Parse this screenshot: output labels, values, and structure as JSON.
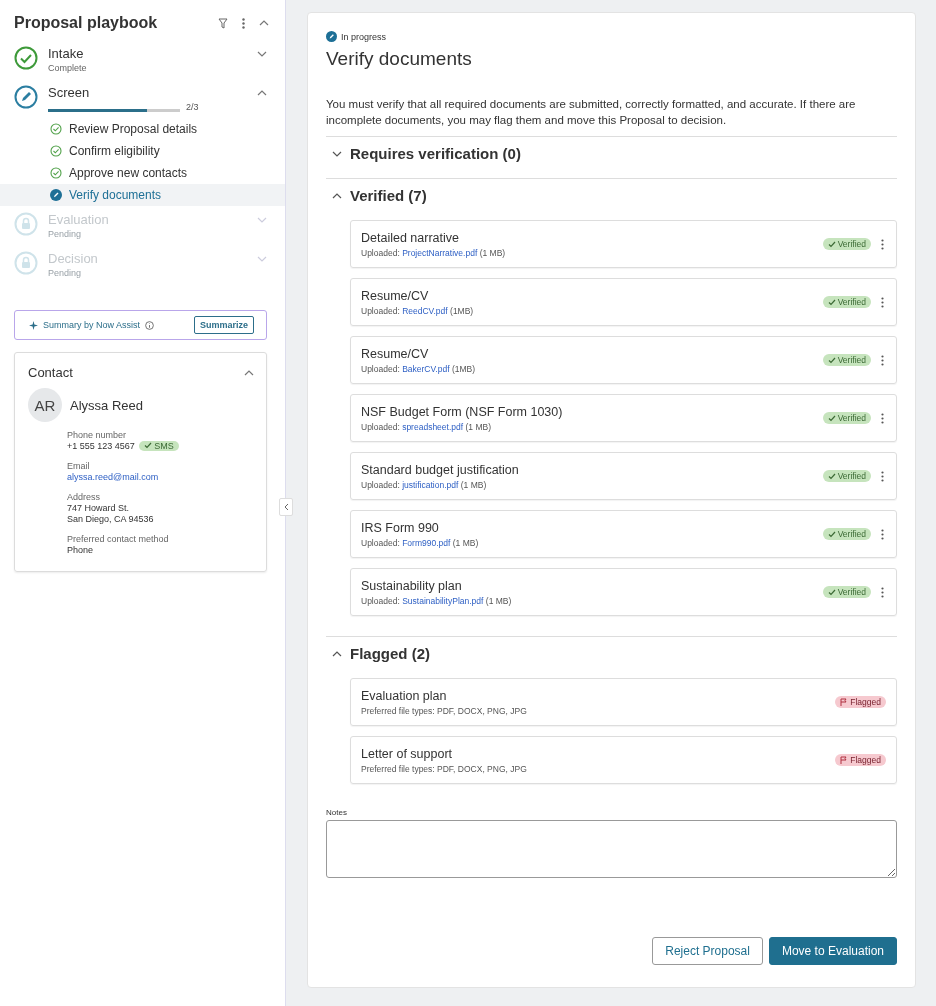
{
  "sidebar": {
    "title": "Proposal playbook",
    "stages": [
      {
        "name": "Intake",
        "kind": "complete",
        "subtitle": "Complete",
        "expanded": false
      },
      {
        "name": "Screen",
        "kind": "active",
        "progress": {
          "level": 0.75,
          "reading": "2/3"
        },
        "expanded": true,
        "steps": [
          {
            "label": "Review Proposal details",
            "done": true,
            "selected": false
          },
          {
            "label": "Confirm eligibility",
            "done": true,
            "selected": false
          },
          {
            "label": "Approve new contacts",
            "done": true,
            "selected": false
          },
          {
            "label": "Verify documents",
            "done": false,
            "selected": true
          }
        ]
      },
      {
        "name": "Evaluation",
        "kind": "locked",
        "subtitle": "Pending",
        "expanded": false
      },
      {
        "name": "Decision",
        "kind": "locked",
        "subtitle": "Pending",
        "expanded": false
      }
    ],
    "assist": {
      "label": "Summary by Now Assist",
      "button": "Summarize"
    },
    "contact": {
      "title": "Contact",
      "expanded": true,
      "initials": "AR",
      "name": "Alyssa Reed",
      "fields": [
        {
          "kind": "phone",
          "label": "Phone number",
          "value": "+1 555 123 4567",
          "badge": "SMS"
        },
        {
          "kind": "link",
          "label": "Email",
          "value": "alyssa.reed@mail.com"
        },
        {
          "kind": "text",
          "label": "Address",
          "lines": [
            "747 Howard St.",
            "San Diego, CA 94536"
          ]
        },
        {
          "kind": "text",
          "label": "Preferred contact method",
          "lines": [
            "Phone"
          ]
        }
      ]
    }
  },
  "main": {
    "status": "In progress",
    "title": "Verify documents",
    "description": "You must verify that all required documents are submitted, correctly formatted, and accurate. If there are incomplete documents, you may flag them and move this Proposal to decision.",
    "sections": [
      {
        "title": "Requires verification (0)",
        "expanded": false
      },
      {
        "title": "Verified (7)",
        "expanded": true,
        "documents": [
          {
            "kind": "verified",
            "name": "Detailed narrative",
            "label": "Uploaded:",
            "file": "ProjectNarrative.pdf",
            "size": "(1 MB)",
            "badge": "Verified"
          },
          {
            "kind": "verified",
            "name": "Resume/CV",
            "label": "Uploaded:",
            "file": "ReedCV.pdf",
            "size": "(1MB)",
            "badge": "Verified"
          },
          {
            "kind": "verified",
            "name": "Resume/CV",
            "label": "Uploaded:",
            "file": "BakerCV.pdf",
            "size": "(1MB)",
            "badge": "Verified"
          },
          {
            "kind": "verified",
            "name": "NSF Budget Form (NSF Form 1030)",
            "label": "Uploaded:",
            "file": "spreadsheet.pdf",
            "size": "(1 MB)",
            "badge": "Verified"
          },
          {
            "kind": "verified",
            "name": "Standard budget justification",
            "label": "Uploaded:",
            "file": "justification.pdf",
            "size": "(1 MB)",
            "badge": "Verified"
          },
          {
            "kind": "verified",
            "name": "IRS Form 990",
            "label": "Uploaded:",
            "file": "Form990.pdf",
            "size": "(1 MB)",
            "badge": "Verified"
          },
          {
            "kind": "verified",
            "name": "Sustainability plan",
            "label": "Uploaded:",
            "file": "SustainabilityPlan.pdf",
            "size": "(1 MB)",
            "badge": "Verified"
          }
        ]
      },
      {
        "title": "Flagged (2)",
        "expanded": true,
        "documents": [
          {
            "kind": "flagged",
            "name": "Evaluation plan",
            "note": "Preferred file types: PDF, DOCX, PNG, JPG",
            "badge": "Flagged"
          },
          {
            "kind": "flagged",
            "name": "Letter of support",
            "note": "Preferred file types: PDF, DOCX, PNG, JPG",
            "badge": "Flagged"
          }
        ]
      }
    ],
    "notes_label": "Notes",
    "buttons": [
      {
        "kind": "secondary",
        "label": "Reject Proposal"
      },
      {
        "kind": "primary",
        "label": "Move to Evaluation"
      }
    ]
  }
}
